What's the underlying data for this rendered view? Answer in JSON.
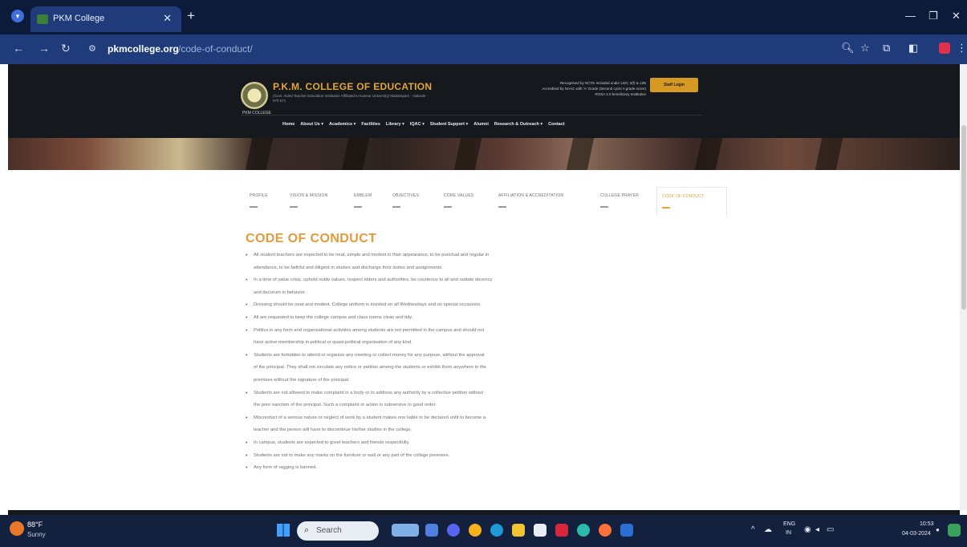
{
  "browser": {
    "tab_title": "PKM College",
    "url_host": "pkmcollege.org",
    "url_path": "/code-of-conduct/",
    "icons": [
      "tab-menu-icon",
      "close-icon",
      "plus-icon",
      "minimize-icon",
      "restore-icon",
      "back-icon",
      "forward-icon",
      "reload-icon",
      "site-info-icon",
      "zoom-icon",
      "star-icon",
      "extensions-icon",
      "sidepanel-icon",
      "profile-icon",
      "kebab-menu-icon"
    ]
  },
  "header": {
    "college_name": "P.K.M. COLLEGE OF EDUCATION",
    "college_sub": "(Govt. Aided Teacher Education Institution Affiliated to Kannur University) Madampam - Alakode - 670 571",
    "accreditation_line1": "Recognised by NCTE Included under UGC 2(f) & 12B",
    "accreditation_line2": "Accredited by NAAC with 'A' Grade (Second cycle A grade score)",
    "accreditation_line3": "ROSA 2.0 beneficiary Institution",
    "staff_login": "Staff Login",
    "logo_caption": "PKM COLLEGE",
    "nav": [
      "Home",
      "About Us ▾",
      "Academics ▾",
      "Facilities",
      "Library ▾",
      "IQAC ▾",
      "Student Support ▾",
      "Alumni",
      "Research & Outreach ▾",
      "Contact"
    ]
  },
  "subtabs": [
    {
      "label": "PROFILE",
      "active": false
    },
    {
      "label": "VISION & MISSION",
      "active": false
    },
    {
      "label": "EMBLEM",
      "active": false
    },
    {
      "label": "OBJECTIVES",
      "active": false
    },
    {
      "label": "CORE VALUES",
      "active": false
    },
    {
      "label": "AFFILIATION & ACCREDITATION",
      "active": false
    },
    {
      "label": "COLLEGE PRAYER",
      "active": false
    },
    {
      "label": "CODE OF CONDUCT",
      "active": true
    }
  ],
  "content": {
    "title": "CODE OF CONDUCT",
    "rules": [
      "All student teachers are expected to be neat, simple and modest in their appearance, to be punctual and regular in",
      "attendance, to be faithful and diligent in studies and discharge their duties and assignments.",
      "In a time of value crisis, uphold noble values, respect elders and authorities, be courteous to all and radiate decency",
      "and decorum in behavior.",
      "Dressing should be neat and modest. College uniform is insisted on all Wednesdays and on special occasions.",
      "All are requested to keep the college campus and class rooms clean and tidy.",
      "Politics in any form and organisational activities among students are not permitted in the campus and should not",
      "have active membership in political or quasi-political organisation of any kind.",
      "Students are forbidden to attend or organize any meeting or collect money for any purpose, without the approval",
      "of the principal. They shall not circulate any notice or petition among the students or exhibit them anywhere in the",
      "premises without the signature of the principal.",
      "Students are not allowed to make complaint in a body or to address any authority by a collective petition without",
      "the prior sanction of the principal. Such a complaint or action is subversive to good order.",
      "Misconduct of a serious nature or neglect of work by a student makes one liable to be declared unfit to become a",
      "teacher and the person will have to discontinue his/her studies in the college.",
      "In campus, students are expected to greet teachers and friends respectfully.",
      "Students are not to make any marks on the furniture or wall or any part of the college premises.",
      "Any form of ragging is banned."
    ],
    "bullet_flags": [
      true,
      false,
      true,
      false,
      true,
      true,
      true,
      false,
      true,
      false,
      false,
      true,
      false,
      true,
      false,
      true,
      true,
      true
    ]
  },
  "taskbar": {
    "weather_temp": "88°F",
    "weather_desc": "Sunny",
    "search_placeholder": "Search",
    "lang1": "ENG",
    "lang2": "IN",
    "time": "10:53",
    "date": "04-03-2024"
  },
  "colors": {
    "accent": "#e3a43a",
    "header_bg": "#15191d",
    "chrome_bg": "#0c1b3a",
    "toolbar_bg": "#1f3b7a",
    "taskbar_bg": "#13203e"
  }
}
